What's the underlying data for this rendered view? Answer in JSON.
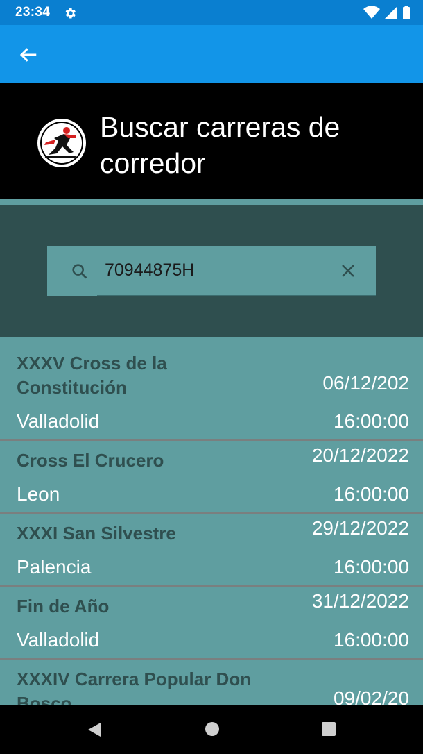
{
  "status": {
    "time": "23:34",
    "icons": [
      "gear-icon",
      "wifi-icon",
      "signal-icon",
      "battery-icon"
    ]
  },
  "appbar": {
    "back_icon": "arrow-left-icon"
  },
  "header": {
    "title": "Buscar carreras de corredor",
    "logo_icon": "runner-logo-icon"
  },
  "search": {
    "value": "70944875H",
    "search_icon": "search-icon",
    "clear_icon": "close-icon"
  },
  "races": [
    {
      "name": "XXXV Cross de la Constitución",
      "date": "06/12/202",
      "city": "Valladolid",
      "time": "16:00:00"
    },
    {
      "name": "Cross El Crucero",
      "date": "20/12/2022",
      "city": "Leon",
      "time": "16:00:00"
    },
    {
      "name": "XXXI San Silvestre",
      "date": "29/12/2022",
      "city": "Palencia",
      "time": "16:00:00"
    },
    {
      "name": "Fin de Año",
      "date": "31/12/2022",
      "city": "Valladolid",
      "time": "16:00:00"
    },
    {
      "name": "XXXIV Carrera Popular Don Bosco",
      "date": "09/02/20",
      "city": "",
      "time": ""
    }
  ],
  "colors": {
    "appbar": "#1295e8",
    "statusbar": "#0a7fd0",
    "list_bg": "#5f9ea0",
    "search_bg": "#2f4f4f",
    "name_text": "#2f4f4f"
  }
}
